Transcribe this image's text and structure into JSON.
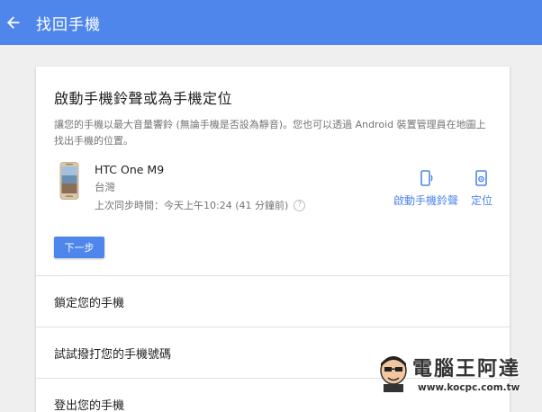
{
  "header": {
    "title": "找回手機",
    "background": "#4f86ec"
  },
  "card": {
    "title": "啟動手機鈴聲或為手機定位",
    "description": "讓您的手機以最大音量響鈴 (無論手機是否設為靜音)。您也可以透過 Android 裝置管理員在地圖上找出手機的位置。",
    "device": {
      "name": "HTC One M9",
      "location": "台灣",
      "last_sync": "上次同步時間：今天上午10:24 (41 分鐘前)",
      "help_icon": "?"
    },
    "actions": {
      "ring_label": "啟動手機鈴聲",
      "locate_label": "定位"
    },
    "next_button": "下一步"
  },
  "options": [
    "鎖定您的手機",
    "試試撥打您的手機號碼",
    "登出您的手機"
  ],
  "watermark": {
    "text": "電腦王阿達",
    "url": "www.kocpc.com.tw"
  },
  "colors": {
    "accent": "#4f86ec",
    "page_bg": "#efefef"
  }
}
